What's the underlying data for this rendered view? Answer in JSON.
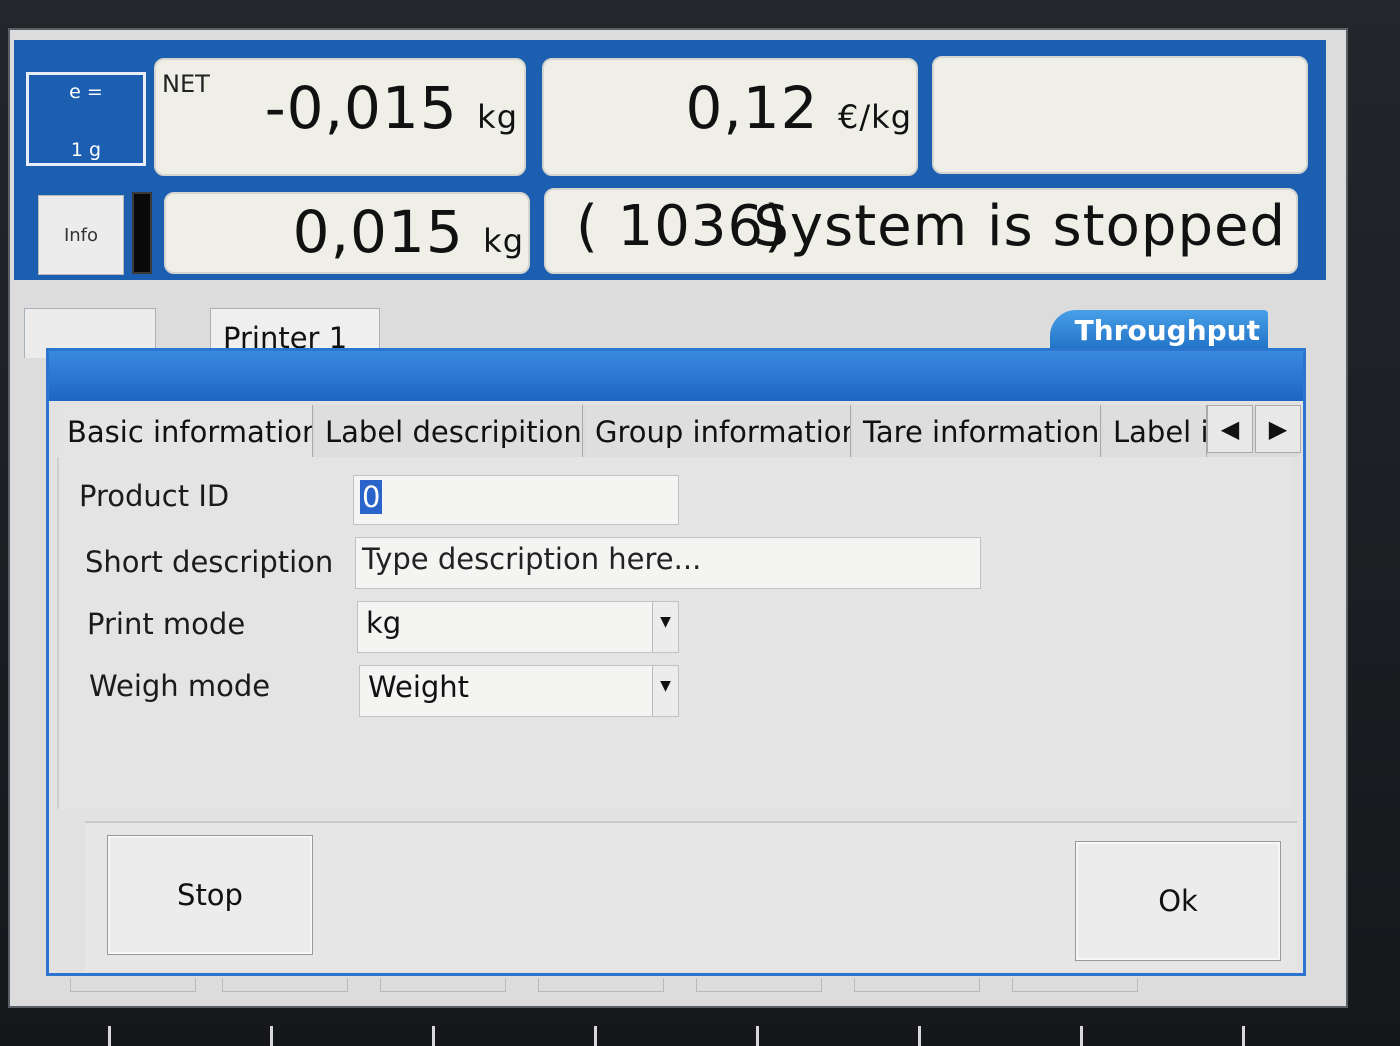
{
  "header": {
    "scale_e_top": "e =",
    "scale_e_bottom": "1 g",
    "info_label": "Info",
    "net_label": "NET",
    "net_value": "-0,015",
    "net_unit": "kg",
    "price_value": "0,12",
    "price_unit": "€/kg",
    "tare_value": "0,015",
    "tare_unit": "kg",
    "status_code": "( 1036)",
    "status_text": "System is stopped"
  },
  "background_tabs": {
    "printer_tab": "Printer 1",
    "throughput_tab": "Throughput"
  },
  "dialog": {
    "tabs": [
      {
        "label": "Basic information"
      },
      {
        "label": "Label descripition"
      },
      {
        "label": "Group information"
      },
      {
        "label": "Tare information"
      },
      {
        "label": "Label i"
      }
    ],
    "arrow_left": "◀",
    "arrow_right": "▶",
    "fields": {
      "product_id_label": "Product ID",
      "product_id_value": "0",
      "short_desc_label": "Short description",
      "short_desc_placeholder": "Type description here...",
      "print_mode_label": "Print mode",
      "print_mode_value": "kg",
      "weigh_mode_label": "Weigh mode",
      "weigh_mode_value": "Weight"
    },
    "stop_button": "Stop",
    "ok_button": "Ok"
  }
}
